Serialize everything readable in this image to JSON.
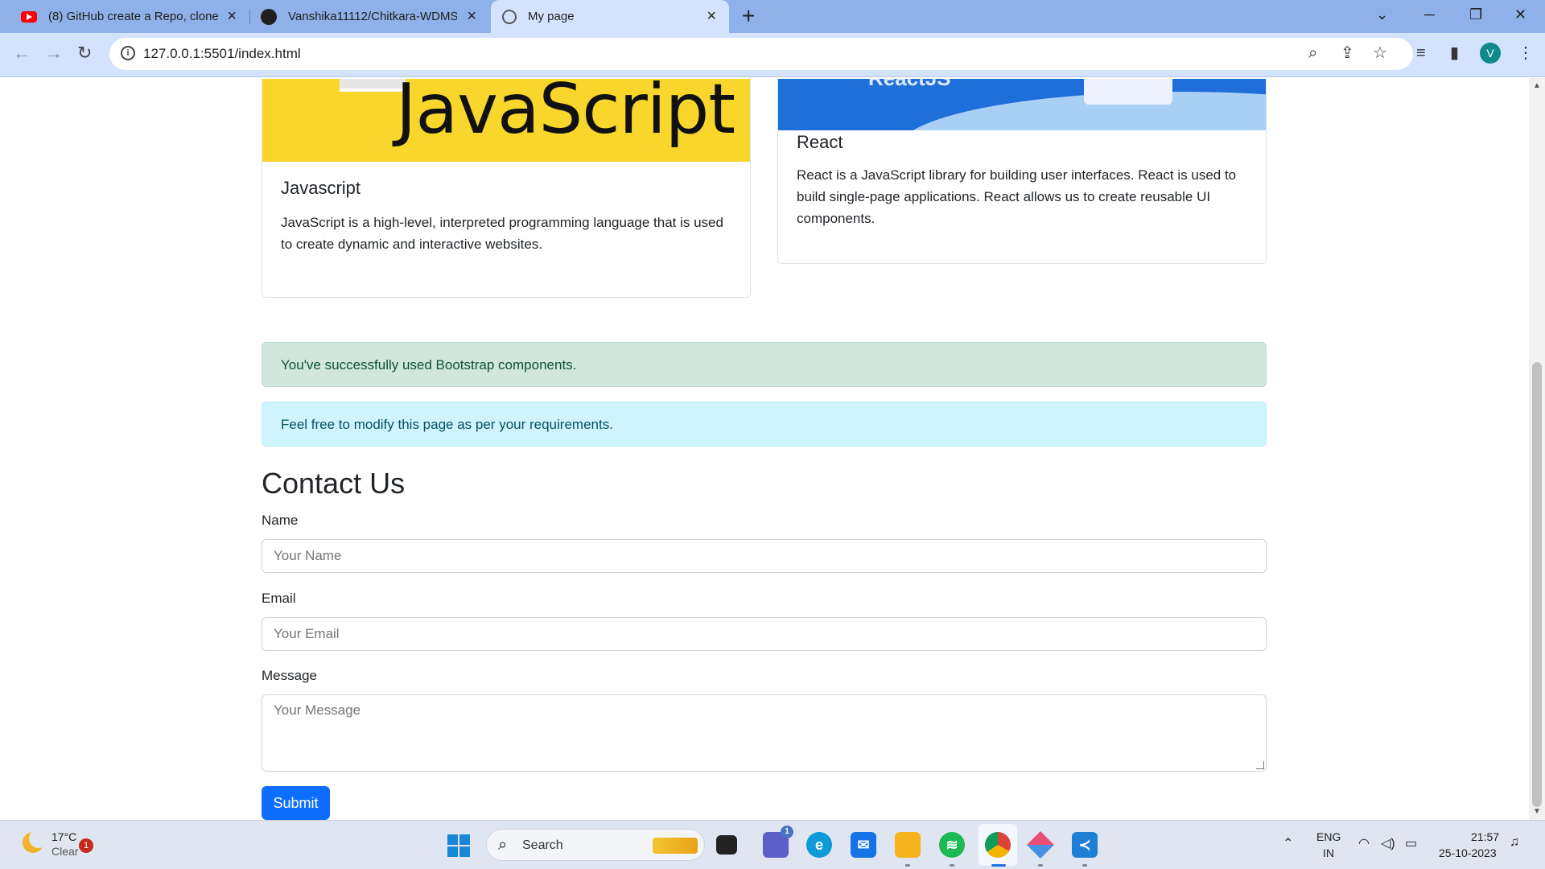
{
  "browser": {
    "tabs": [
      {
        "title": "(8) GitHub create a Repo, clone",
        "icon": "youtube-icon"
      },
      {
        "title": "Vanshika11112/Chitkara-WDMS",
        "icon": "github-icon"
      },
      {
        "title": "My page",
        "icon": "globe-icon"
      }
    ],
    "url": "127.0.0.1:5501/index.html",
    "profile_initial": "V"
  },
  "cards": [
    {
      "image_text": "JavaScript",
      "title": "Javascript",
      "text": "JavaScript is a high-level, interpreted programming language that is used to create dynamic and interactive websites."
    },
    {
      "image_text": "ReactJS",
      "title": "React",
      "text": "React is a JavaScript library for building user interfaces. React is used to build single-page applications. React allows us to create reusable UI components."
    }
  ],
  "alerts": {
    "success": "You've successfully used Bootstrap components.",
    "info": "Feel free to modify this page as per your requirements."
  },
  "contact": {
    "heading": "Contact Us",
    "name_label": "Name",
    "name_placeholder": "Your Name",
    "email_label": "Email",
    "email_placeholder": "Your Email",
    "message_label": "Message",
    "message_placeholder": "Your Message",
    "submit_label": "Submit"
  },
  "taskbar": {
    "weather_temp": "17°C",
    "weather_desc": "Clear",
    "weather_badge": "1",
    "search_label": "Search",
    "teams_badge": "1",
    "lang_line1": "ENG",
    "lang_line2": "IN",
    "time": "21:57",
    "date": "25-10-2023"
  },
  "colors": {
    "chrome_tabbar": "#8fb0e8",
    "chrome_toolbar": "#d3e3fd",
    "js_yellow": "#f8d62c",
    "primary": "#0d6efd",
    "success_bg": "#d1e7dd",
    "info_bg": "#cff4fc"
  }
}
